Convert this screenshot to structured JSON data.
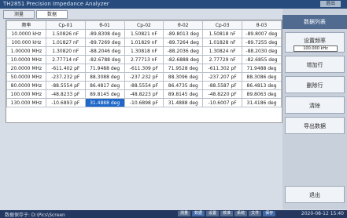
{
  "window": {
    "title": "TH2851 Precision Impedance Analyzer",
    "menu_button": "退出"
  },
  "tabs": [
    {
      "label": "测量"
    },
    {
      "label": "数据"
    }
  ],
  "table": {
    "headers": [
      "频率",
      "Cp-01",
      "θ-01",
      "Cp-02",
      "θ-02",
      "Cp-03",
      "θ-03"
    ],
    "rows": [
      [
        "10.0000 kHz",
        "1.50826 nF",
        "-89.8308 deg",
        "1.50821 nF",
        "-89.8013 deg",
        "1.50818 nF",
        "-89.8007 deg"
      ],
      [
        "100.000 kHz",
        "1.01827 nF",
        "-89.7269 deg",
        "1.01829 nF",
        "-89.7264 deg",
        "1.01828 nF",
        "-89.7255 deg"
      ],
      [
        "1.00000 MHz",
        "1.30820 nF",
        "-88.2046 deg",
        "1.30818 nF",
        "-88.2036 deg",
        "1.30824 nF",
        "-88.2030 deg"
      ],
      [
        "10.0000 MHz",
        "2.77714 nF",
        "-82.6788 deg",
        "2.77713 nF",
        "-82.6888 deg",
        "2.77729 nF",
        "-82.6855 deg"
      ],
      [
        "20.0000 MHz",
        "-611.402 pF",
        "71.9488 deg",
        "-611.309 pF",
        "71.9528 deg",
        "-611.302 pF",
        "71.9488 deg"
      ],
      [
        "50.0000 MHz",
        "-237.232 pF",
        "88.3088 deg",
        "-237.232 pF",
        "88.3096 deg",
        "-237.207 pF",
        "88.3086 deg"
      ],
      [
        "80.0000 MHz",
        "-88.5554 pF",
        "86.4817 deg",
        "-88.5554 pF",
        "86.4735 deg",
        "-88.5587 pF",
        "86.4813 deg"
      ],
      [
        "100.000 MHz",
        "-48.8233 pF",
        "89.8145 deg",
        "-48.8223 pF",
        "89.8145 deg",
        "-48.8220 pF",
        "89.8063 deg"
      ],
      [
        "130.000 MHz",
        "-10.6893 pF",
        "31.4888 deg",
        "-10.6898 pF",
        "31.4888 deg",
        "-10.6007 pF",
        "31.4186 deg"
      ]
    ]
  },
  "side": {
    "header": "数据列表",
    "setfreq_label": "设置频率",
    "setfreq_value": "100.000 kHz",
    "buttons": [
      "增加行",
      "删除行",
      "清除",
      "导出数据"
    ],
    "exit": "退出"
  },
  "status": {
    "left": "数据保存于: D:\\Pics\\Screen",
    "pills": [
      "测量",
      "数据",
      "设置",
      "校准",
      "系统",
      "文件",
      "保存"
    ],
    "right": "2020-08-12 15:40"
  }
}
